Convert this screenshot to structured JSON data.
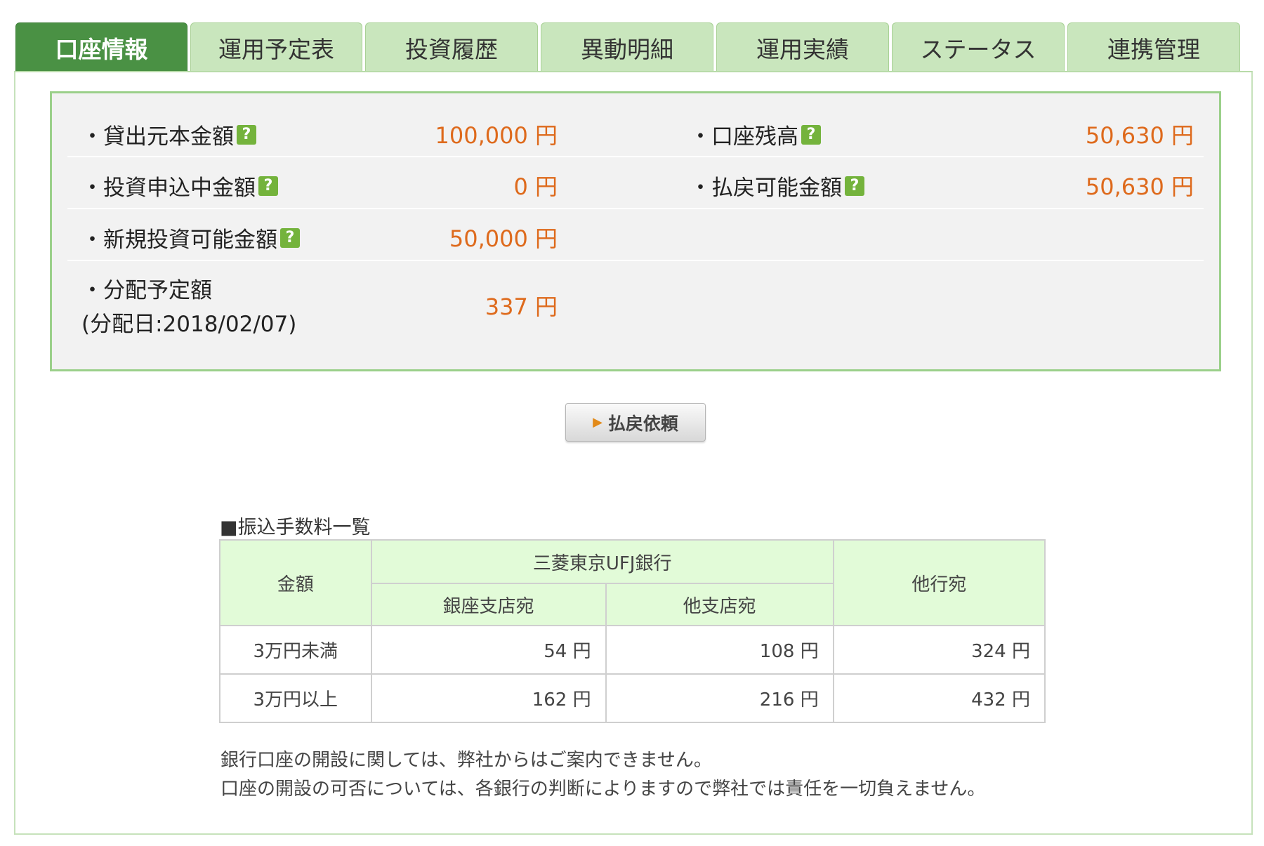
{
  "tabs": [
    {
      "label": "口座情報",
      "active": true
    },
    {
      "label": "運用予定表",
      "active": false
    },
    {
      "label": "投資履歴",
      "active": false
    },
    {
      "label": "異動明細",
      "active": false
    },
    {
      "label": "運用実績",
      "active": false
    },
    {
      "label": "ステータス",
      "active": false
    },
    {
      "label": "連携管理",
      "active": false
    }
  ],
  "account": {
    "loan_principal": {
      "label": "・貸出元本金額",
      "value": "100,000 円"
    },
    "account_balance": {
      "label": "・口座残高",
      "value": "50,630 円"
    },
    "pending_investment": {
      "label": "・投資申込中金額",
      "value": "0 円"
    },
    "withdrawable": {
      "label": "・払戻可能金額",
      "value": "50,630 円"
    },
    "new_investable": {
      "label": "・新規投資可能金額",
      "value": "50,000 円"
    },
    "distribution": {
      "label": "・分配予定額",
      "sublabel": "(分配日:2018/02/07)",
      "value": "337 円"
    },
    "help_glyph": "?"
  },
  "withdraw_button": {
    "label": "払戻依頼",
    "icon": "play-triangle-icon"
  },
  "fee_table": {
    "title": "■振込手数料一覧",
    "header_amount": "金額",
    "header_bank": "三菱東京UFJ銀行",
    "header_ginza": "銀座支店宛",
    "header_other_branch": "他支店宛",
    "header_other_bank": "他行宛",
    "rows": [
      {
        "amount": "3万円未満",
        "ginza": "54 円",
        "other_branch": "108 円",
        "other_bank": "324 円"
      },
      {
        "amount": "3万円以上",
        "ginza": "162 円",
        "other_branch": "216 円",
        "other_bank": "432 円"
      }
    ]
  },
  "notes": [
    "銀行口座の開設に関しては、弊社からはご案内できません。",
    "口座の開設の可否については、各銀行の判断によりますので弊社では責任を一切負えません。"
  ],
  "colors": {
    "tab_active": "#4a9144",
    "tab_inactive": "#c9e6bd",
    "value_orange": "#de6a1c",
    "help_green": "#74b33c",
    "table_header_bg": "#e2fbd8"
  }
}
